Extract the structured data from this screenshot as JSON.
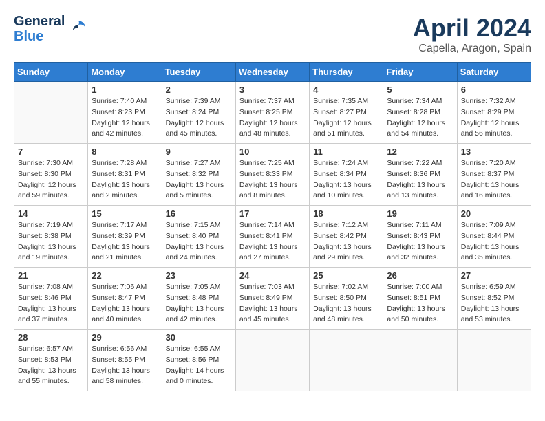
{
  "header": {
    "logo_general": "General",
    "logo_blue": "Blue",
    "title": "April 2024",
    "subtitle": "Capella, Aragon, Spain"
  },
  "columns": [
    "Sunday",
    "Monday",
    "Tuesday",
    "Wednesday",
    "Thursday",
    "Friday",
    "Saturday"
  ],
  "weeks": [
    {
      "shade": false,
      "days": [
        {
          "num": "",
          "sunrise": "",
          "sunset": "",
          "daylight": ""
        },
        {
          "num": "1",
          "sunrise": "Sunrise: 7:40 AM",
          "sunset": "Sunset: 8:23 PM",
          "daylight": "Daylight: 12 hours and 42 minutes."
        },
        {
          "num": "2",
          "sunrise": "Sunrise: 7:39 AM",
          "sunset": "Sunset: 8:24 PM",
          "daylight": "Daylight: 12 hours and 45 minutes."
        },
        {
          "num": "3",
          "sunrise": "Sunrise: 7:37 AM",
          "sunset": "Sunset: 8:25 PM",
          "daylight": "Daylight: 12 hours and 48 minutes."
        },
        {
          "num": "4",
          "sunrise": "Sunrise: 7:35 AM",
          "sunset": "Sunset: 8:27 PM",
          "daylight": "Daylight: 12 hours and 51 minutes."
        },
        {
          "num": "5",
          "sunrise": "Sunrise: 7:34 AM",
          "sunset": "Sunset: 8:28 PM",
          "daylight": "Daylight: 12 hours and 54 minutes."
        },
        {
          "num": "6",
          "sunrise": "Sunrise: 7:32 AM",
          "sunset": "Sunset: 8:29 PM",
          "daylight": "Daylight: 12 hours and 56 minutes."
        }
      ]
    },
    {
      "shade": true,
      "days": [
        {
          "num": "7",
          "sunrise": "Sunrise: 7:30 AM",
          "sunset": "Sunset: 8:30 PM",
          "daylight": "Daylight: 12 hours and 59 minutes."
        },
        {
          "num": "8",
          "sunrise": "Sunrise: 7:28 AM",
          "sunset": "Sunset: 8:31 PM",
          "daylight": "Daylight: 13 hours and 2 minutes."
        },
        {
          "num": "9",
          "sunrise": "Sunrise: 7:27 AM",
          "sunset": "Sunset: 8:32 PM",
          "daylight": "Daylight: 13 hours and 5 minutes."
        },
        {
          "num": "10",
          "sunrise": "Sunrise: 7:25 AM",
          "sunset": "Sunset: 8:33 PM",
          "daylight": "Daylight: 13 hours and 8 minutes."
        },
        {
          "num": "11",
          "sunrise": "Sunrise: 7:24 AM",
          "sunset": "Sunset: 8:34 PM",
          "daylight": "Daylight: 13 hours and 10 minutes."
        },
        {
          "num": "12",
          "sunrise": "Sunrise: 7:22 AM",
          "sunset": "Sunset: 8:36 PM",
          "daylight": "Daylight: 13 hours and 13 minutes."
        },
        {
          "num": "13",
          "sunrise": "Sunrise: 7:20 AM",
          "sunset": "Sunset: 8:37 PM",
          "daylight": "Daylight: 13 hours and 16 minutes."
        }
      ]
    },
    {
      "shade": false,
      "days": [
        {
          "num": "14",
          "sunrise": "Sunrise: 7:19 AM",
          "sunset": "Sunset: 8:38 PM",
          "daylight": "Daylight: 13 hours and 19 minutes."
        },
        {
          "num": "15",
          "sunrise": "Sunrise: 7:17 AM",
          "sunset": "Sunset: 8:39 PM",
          "daylight": "Daylight: 13 hours and 21 minutes."
        },
        {
          "num": "16",
          "sunrise": "Sunrise: 7:15 AM",
          "sunset": "Sunset: 8:40 PM",
          "daylight": "Daylight: 13 hours and 24 minutes."
        },
        {
          "num": "17",
          "sunrise": "Sunrise: 7:14 AM",
          "sunset": "Sunset: 8:41 PM",
          "daylight": "Daylight: 13 hours and 27 minutes."
        },
        {
          "num": "18",
          "sunrise": "Sunrise: 7:12 AM",
          "sunset": "Sunset: 8:42 PM",
          "daylight": "Daylight: 13 hours and 29 minutes."
        },
        {
          "num": "19",
          "sunrise": "Sunrise: 7:11 AM",
          "sunset": "Sunset: 8:43 PM",
          "daylight": "Daylight: 13 hours and 32 minutes."
        },
        {
          "num": "20",
          "sunrise": "Sunrise: 7:09 AM",
          "sunset": "Sunset: 8:44 PM",
          "daylight": "Daylight: 13 hours and 35 minutes."
        }
      ]
    },
    {
      "shade": true,
      "days": [
        {
          "num": "21",
          "sunrise": "Sunrise: 7:08 AM",
          "sunset": "Sunset: 8:46 PM",
          "daylight": "Daylight: 13 hours and 37 minutes."
        },
        {
          "num": "22",
          "sunrise": "Sunrise: 7:06 AM",
          "sunset": "Sunset: 8:47 PM",
          "daylight": "Daylight: 13 hours and 40 minutes."
        },
        {
          "num": "23",
          "sunrise": "Sunrise: 7:05 AM",
          "sunset": "Sunset: 8:48 PM",
          "daylight": "Daylight: 13 hours and 42 minutes."
        },
        {
          "num": "24",
          "sunrise": "Sunrise: 7:03 AM",
          "sunset": "Sunset: 8:49 PM",
          "daylight": "Daylight: 13 hours and 45 minutes."
        },
        {
          "num": "25",
          "sunrise": "Sunrise: 7:02 AM",
          "sunset": "Sunset: 8:50 PM",
          "daylight": "Daylight: 13 hours and 48 minutes."
        },
        {
          "num": "26",
          "sunrise": "Sunrise: 7:00 AM",
          "sunset": "Sunset: 8:51 PM",
          "daylight": "Daylight: 13 hours and 50 minutes."
        },
        {
          "num": "27",
          "sunrise": "Sunrise: 6:59 AM",
          "sunset": "Sunset: 8:52 PM",
          "daylight": "Daylight: 13 hours and 53 minutes."
        }
      ]
    },
    {
      "shade": false,
      "days": [
        {
          "num": "28",
          "sunrise": "Sunrise: 6:57 AM",
          "sunset": "Sunset: 8:53 PM",
          "daylight": "Daylight: 13 hours and 55 minutes."
        },
        {
          "num": "29",
          "sunrise": "Sunrise: 6:56 AM",
          "sunset": "Sunset: 8:55 PM",
          "daylight": "Daylight: 13 hours and 58 minutes."
        },
        {
          "num": "30",
          "sunrise": "Sunrise: 6:55 AM",
          "sunset": "Sunset: 8:56 PM",
          "daylight": "Daylight: 14 hours and 0 minutes."
        },
        {
          "num": "",
          "sunrise": "",
          "sunset": "",
          "daylight": ""
        },
        {
          "num": "",
          "sunrise": "",
          "sunset": "",
          "daylight": ""
        },
        {
          "num": "",
          "sunrise": "",
          "sunset": "",
          "daylight": ""
        },
        {
          "num": "",
          "sunrise": "",
          "sunset": "",
          "daylight": ""
        }
      ]
    }
  ]
}
